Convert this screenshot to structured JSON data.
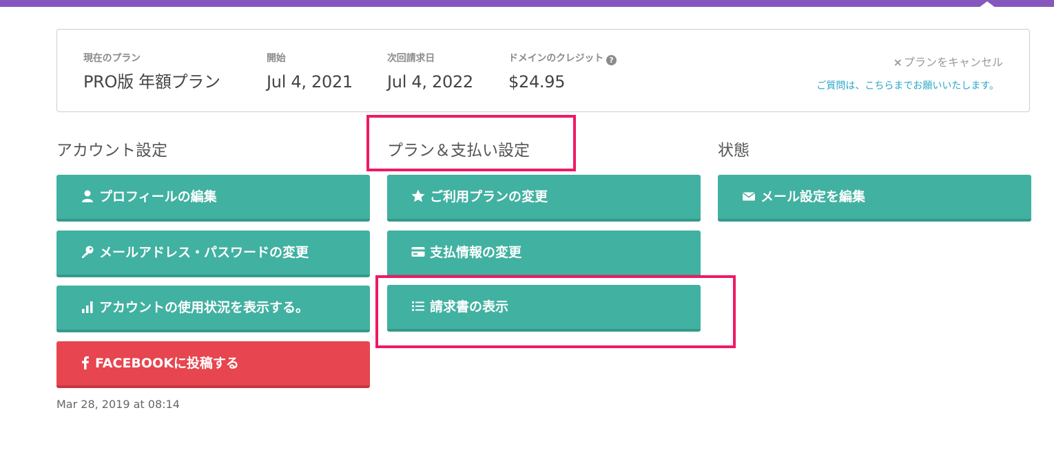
{
  "plan": {
    "current_plan_label": "現在のプラン",
    "current_plan_value": "PRO版 年額プラン",
    "start_label": "開始",
    "start_value": "Jul 4, 2021",
    "next_billing_label": "次回請求日",
    "next_billing_value": "Jul 4, 2022",
    "domain_credit_label": "ドメインのクレジット",
    "domain_credit_value": "$24.95",
    "help_icon": "?",
    "cancel_link": "プランをキャンセル",
    "cancel_icon": "×",
    "help_link": "ご質問は、こちらまでお願いいたします。"
  },
  "sections": {
    "account": {
      "title": "アカウント設定",
      "buttons": [
        {
          "label": "プロフィールの編集",
          "icon": "user-icon"
        },
        {
          "label": "メールアドレス・パスワードの変更",
          "icon": "key-icon"
        },
        {
          "label": "アカウントの使用状況を表示する。",
          "icon": "bar-chart-icon"
        },
        {
          "label": "FACEBOOKに投稿する",
          "icon": "facebook-icon"
        }
      ]
    },
    "plan_payment": {
      "title": "プラン＆支払い設定",
      "buttons": [
        {
          "label": "ご利用プランの変更",
          "icon": "star-icon"
        },
        {
          "label": "支払情報の変更",
          "icon": "credit-card-icon"
        },
        {
          "label": "請求書の表示",
          "icon": "list-icon"
        }
      ]
    },
    "status": {
      "title": "状態",
      "buttons": [
        {
          "label": "メール設定を編集",
          "icon": "envelope-icon"
        }
      ]
    }
  },
  "timestamp": "Mar 28, 2019 at 08:14",
  "colors": {
    "top_bar": "#8658bd",
    "button_teal": "#41b1a1",
    "button_red": "#e7454f",
    "highlight": "#ee1a66",
    "link": "#2aa6c9"
  }
}
